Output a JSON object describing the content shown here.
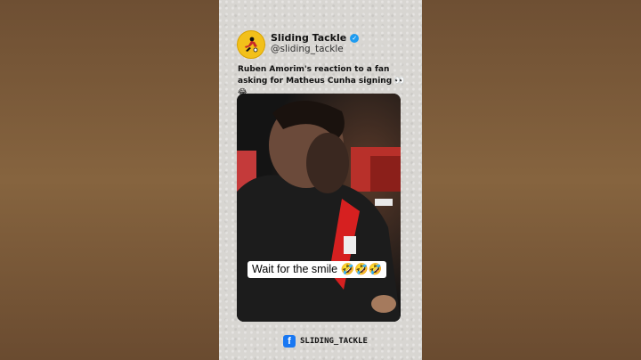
{
  "post": {
    "account_name": "Sliding Tackle",
    "handle": "@sliding_tackle",
    "verified_icon": "verified-badge-icon",
    "text": "Ruben Amorim's reaction to a fan asking for Matheus Cunha signing 👀😂",
    "video_caption": "Wait for the smile 🤣🤣🤣"
  },
  "footer": {
    "icon": "facebook-icon",
    "label": "SLIDING_TACKLE"
  },
  "colors": {
    "background": "#7a5a3c",
    "card": "#d8d6d2",
    "avatar": "#f2c01a",
    "verified": "#1d9bf0",
    "facebook": "#1877f2"
  }
}
